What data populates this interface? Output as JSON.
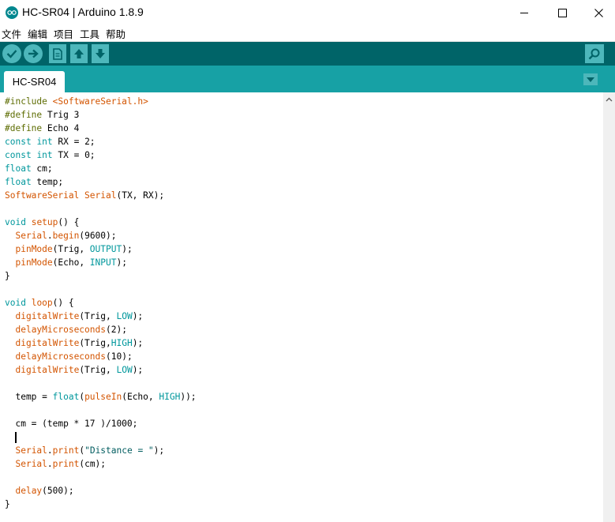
{
  "window": {
    "title": "HC-SR04 | Arduino 1.8.9",
    "min_glyph": "—",
    "max_glyph": "☐",
    "close_glyph": "✕"
  },
  "menu": [
    "文件",
    "编辑",
    "项目",
    "工具",
    "帮助"
  ],
  "toolbar": {
    "buttons": [
      {
        "name": "verify",
        "icon": "checkmark-icon"
      },
      {
        "name": "upload",
        "icon": "arrow-right-icon"
      },
      {
        "name": "new",
        "icon": "new-file-icon"
      },
      {
        "name": "open",
        "icon": "arrow-up-icon"
      },
      {
        "name": "save",
        "icon": "arrow-down-icon"
      },
      {
        "name": "serial-monitor",
        "icon": "magnifier-icon"
      }
    ]
  },
  "tabs": [
    {
      "label": "HC-SR04",
      "active": true
    }
  ],
  "colors": {
    "toolbar": "#006468",
    "tabbar": "#17a1a5",
    "button": "#4db7bb",
    "keyword": "#00979c",
    "function": "#d35400",
    "preprocessor": "#5e6d03"
  },
  "code": [
    [
      {
        "t": "#include ",
        "c": "pp"
      },
      {
        "t": "<SoftwareSerial.h>",
        "c": "func"
      }
    ],
    [
      {
        "t": "#define ",
        "c": "pp"
      },
      {
        "t": "Trig 3",
        "c": ""
      }
    ],
    [
      {
        "t": "#define ",
        "c": "pp"
      },
      {
        "t": "Echo 4",
        "c": ""
      }
    ],
    [
      {
        "t": "const",
        "c": "type"
      },
      {
        "t": " ",
        "c": ""
      },
      {
        "t": "int",
        "c": "type"
      },
      {
        "t": " RX = 2;",
        "c": ""
      }
    ],
    [
      {
        "t": "const",
        "c": "type"
      },
      {
        "t": " ",
        "c": ""
      },
      {
        "t": "int",
        "c": "type"
      },
      {
        "t": " TX = 0;",
        "c": ""
      }
    ],
    [
      {
        "t": "float",
        "c": "type"
      },
      {
        "t": " cm;",
        "c": ""
      }
    ],
    [
      {
        "t": "float",
        "c": "type"
      },
      {
        "t": " temp;",
        "c": ""
      }
    ],
    [
      {
        "t": "SoftwareSerial",
        "c": "class"
      },
      {
        "t": " ",
        "c": ""
      },
      {
        "t": "Serial",
        "c": "class"
      },
      {
        "t": "(TX, RX);",
        "c": ""
      }
    ],
    [],
    [
      {
        "t": "void",
        "c": "type"
      },
      {
        "t": " ",
        "c": ""
      },
      {
        "t": "setup",
        "c": "func"
      },
      {
        "t": "() {",
        "c": ""
      }
    ],
    [
      {
        "t": "  ",
        "c": ""
      },
      {
        "t": "Serial",
        "c": "class"
      },
      {
        "t": ".",
        "c": ""
      },
      {
        "t": "begin",
        "c": "func"
      },
      {
        "t": "(9600);",
        "c": ""
      }
    ],
    [
      {
        "t": "  ",
        "c": ""
      },
      {
        "t": "pinMode",
        "c": "func"
      },
      {
        "t": "(Trig, ",
        "c": ""
      },
      {
        "t": "OUTPUT",
        "c": "lit"
      },
      {
        "t": ");",
        "c": ""
      }
    ],
    [
      {
        "t": "  ",
        "c": ""
      },
      {
        "t": "pinMode",
        "c": "func"
      },
      {
        "t": "(Echo, ",
        "c": ""
      },
      {
        "t": "INPUT",
        "c": "lit"
      },
      {
        "t": ");",
        "c": ""
      }
    ],
    [
      {
        "t": "}",
        "c": ""
      }
    ],
    [],
    [
      {
        "t": "void",
        "c": "type"
      },
      {
        "t": " ",
        "c": ""
      },
      {
        "t": "loop",
        "c": "func"
      },
      {
        "t": "() {",
        "c": ""
      }
    ],
    [
      {
        "t": "  ",
        "c": ""
      },
      {
        "t": "digitalWrite",
        "c": "func"
      },
      {
        "t": "(Trig, ",
        "c": ""
      },
      {
        "t": "LOW",
        "c": "lit"
      },
      {
        "t": ");",
        "c": ""
      }
    ],
    [
      {
        "t": "  ",
        "c": ""
      },
      {
        "t": "delayMicroseconds",
        "c": "func"
      },
      {
        "t": "(2);",
        "c": ""
      }
    ],
    [
      {
        "t": "  ",
        "c": ""
      },
      {
        "t": "digitalWrite",
        "c": "func"
      },
      {
        "t": "(Trig,",
        "c": ""
      },
      {
        "t": "HIGH",
        "c": "lit"
      },
      {
        "t": ");",
        "c": ""
      }
    ],
    [
      {
        "t": "  ",
        "c": ""
      },
      {
        "t": "delayMicroseconds",
        "c": "func"
      },
      {
        "t": "(10);",
        "c": ""
      }
    ],
    [
      {
        "t": "  ",
        "c": ""
      },
      {
        "t": "digitalWrite",
        "c": "func"
      },
      {
        "t": "(Trig, ",
        "c": ""
      },
      {
        "t": "LOW",
        "c": "lit"
      },
      {
        "t": ");",
        "c": ""
      }
    ],
    [],
    [
      {
        "t": "  temp = ",
        "c": ""
      },
      {
        "t": "float",
        "c": "type"
      },
      {
        "t": "(",
        "c": ""
      },
      {
        "t": "pulseIn",
        "c": "func"
      },
      {
        "t": "(Echo, ",
        "c": ""
      },
      {
        "t": "HIGH",
        "c": "lit"
      },
      {
        "t": "));",
        "c": ""
      }
    ],
    [],
    [
      {
        "t": "  cm = (temp * 17 )/1000;",
        "c": ""
      }
    ],
    [
      {
        "t": "  ",
        "c": ""
      },
      {
        "t": "",
        "c": "cursor"
      }
    ],
    [
      {
        "t": "  ",
        "c": ""
      },
      {
        "t": "Serial",
        "c": "class"
      },
      {
        "t": ".",
        "c": ""
      },
      {
        "t": "print",
        "c": "func"
      },
      {
        "t": "(",
        "c": ""
      },
      {
        "t": "\"Distance = \"",
        "c": "str"
      },
      {
        "t": ");",
        "c": ""
      }
    ],
    [
      {
        "t": "  ",
        "c": ""
      },
      {
        "t": "Serial",
        "c": "class"
      },
      {
        "t": ".",
        "c": ""
      },
      {
        "t": "print",
        "c": "func"
      },
      {
        "t": "(cm);",
        "c": ""
      }
    ],
    [],
    [
      {
        "t": "  ",
        "c": ""
      },
      {
        "t": "delay",
        "c": "func"
      },
      {
        "t": "(500);",
        "c": ""
      }
    ],
    [
      {
        "t": "}",
        "c": ""
      }
    ]
  ]
}
